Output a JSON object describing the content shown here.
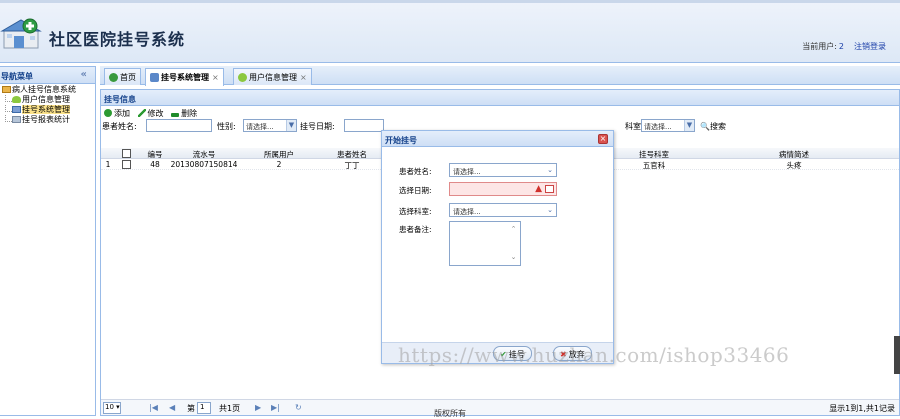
{
  "header": {
    "title": "社区医院挂号系统",
    "current_user_label": "当前用户:",
    "current_user_value": "2",
    "logout": "注销登录"
  },
  "nav": {
    "title": "导航菜单",
    "collapse": "«",
    "items": [
      {
        "label": "病人挂号信息系统",
        "icon": "folder-icon"
      },
      {
        "label": "用户信息管理",
        "icon": "user-icon"
      },
      {
        "label": "挂号系统管理",
        "icon": "book-icon",
        "selected": true
      },
      {
        "label": "挂号报表统计",
        "icon": "stat-icon"
      }
    ]
  },
  "tabs": [
    {
      "label": "首页",
      "closable": false
    },
    {
      "label": "挂号系统管理",
      "closable": true,
      "active": true
    },
    {
      "label": "用户信息管理",
      "closable": true
    }
  ],
  "tab_close": "×",
  "panel": {
    "title": "挂号信息",
    "toolbar": {
      "add": "添加",
      "edit": "修改",
      "delete": "删除"
    },
    "search": {
      "name_label": "患者姓名:",
      "gender_label": "性别:",
      "gender_value": "请选择...",
      "date_label": "挂号日期:",
      "dept_label": "科室:",
      "dept_value": "请选择...",
      "search_button": "搜索"
    },
    "columns": [
      "编号",
      "流水号",
      "所属用户",
      "患者姓名",
      "挂号科室",
      "病情简述"
    ],
    "rows": [
      {
        "rownum": "1",
        "id": "48",
        "serial": "20130807150814",
        "user": "2",
        "patient": "丁丁",
        "dept": "五官科",
        "desc": "头疼"
      }
    ],
    "pager": {
      "page_size": "10",
      "page_label": "第",
      "page_value": "1",
      "total_pages": "共1页",
      "summary": "显示1到1,共1记录"
    }
  },
  "footer": "版权所有",
  "dialog": {
    "title": "开始挂号",
    "close": "×",
    "fields": {
      "name_label": "患者姓名:",
      "name_value": "请选择...",
      "date_label": "选择日期:",
      "dept_label": "选择科室:",
      "dept_value": "请选择...",
      "note_label": "患者备注:"
    },
    "buttons": {
      "submit": "挂号",
      "cancel": "放弃"
    }
  },
  "watermark": "https://www.huzhan.com/ishop33466",
  "colors": {
    "panel_border": "#99bbe8",
    "header_bg": "#dde8f6",
    "title_text": "#15428b",
    "selected_bg": "#fce38c"
  }
}
